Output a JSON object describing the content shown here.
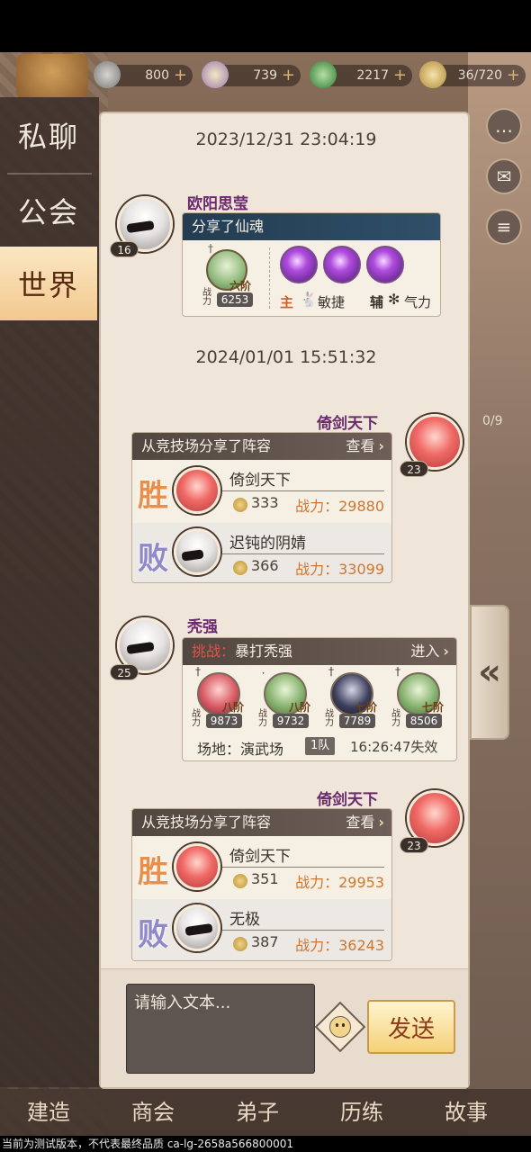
{
  "resources": [
    {
      "icon": "silver-coin-icon",
      "value": "800"
    },
    {
      "icon": "spirit-icon",
      "value": "739"
    },
    {
      "icon": "jade-icon",
      "value": "2217"
    },
    {
      "icon": "food-icon",
      "value": "36/720"
    }
  ],
  "tabs": [
    {
      "label": "私聊"
    },
    {
      "label": "公会"
    },
    {
      "label": "世界"
    }
  ],
  "messages": {
    "ts1": "2023/12/31 23:04:19",
    "m1": {
      "user": "欧阳思莹",
      "level": "16",
      "card_title": "分享了仙魂",
      "hero_stage": "六阶",
      "hero_power_label": "战力",
      "hero_power": "6253",
      "main_label": "主",
      "main_attr": "敏捷",
      "aux_label": "辅",
      "aux_attr": "气力"
    },
    "ts2": "2024/01/01 15:51:32",
    "m2": {
      "user": "倚剑天下",
      "level": "23",
      "card_title": "从竞技场分享了阵容",
      "action": "查看",
      "win_glyph": "胜",
      "lose_glyph": "败",
      "win_name": "倚剑天下",
      "win_score": "333",
      "win_power": "战力：29880",
      "lose_name": "迟钝的阴婧",
      "lose_score": "366",
      "lose_power": "战力：33099"
    },
    "m3": {
      "user": "秃强",
      "level": "25",
      "challenge_label": "挑战：",
      "challenge_title": "暴打秃强",
      "action": "进入",
      "heroes": [
        {
          "stage": "八阶",
          "power": "9873"
        },
        {
          "stage": "八阶",
          "power": "9732"
        },
        {
          "stage": "七阶",
          "power": "7789"
        },
        {
          "stage": "七阶",
          "power": "8506"
        }
      ],
      "power_label": "战力",
      "venue": "场地：演武场",
      "team": "1队",
      "expire": "16:26:47失效"
    },
    "m4": {
      "user": "倚剑天下",
      "level": "23",
      "card_title": "从竞技场分享了阵容",
      "action": "查看",
      "win_glyph": "胜",
      "lose_glyph": "败",
      "win_name": "倚剑天下",
      "win_score": "351",
      "win_power": "战力：29953",
      "lose_name": "无极",
      "lose_score": "387",
      "lose_power": "战力：36243"
    }
  },
  "input": {
    "placeholder": "请输入文本...",
    "send_label": "发送"
  },
  "side_partial": "0/9",
  "bottom_nav": [
    {
      "label": "建造"
    },
    {
      "label": "商会"
    },
    {
      "label": "弟子"
    },
    {
      "label": "历练"
    },
    {
      "label": "故事"
    }
  ],
  "footer_note": "当前为测试版本，不代表最终品质 ca-lg-2658a566800001"
}
